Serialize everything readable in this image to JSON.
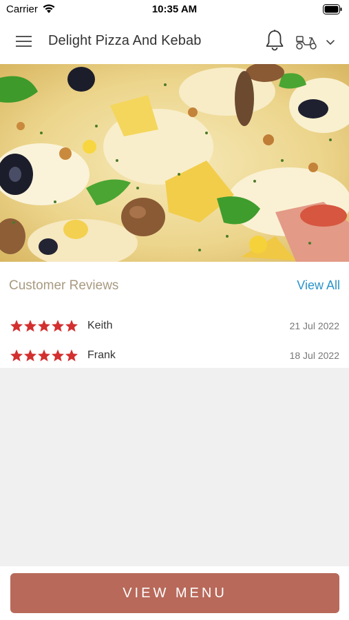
{
  "status_bar": {
    "carrier": "Carrier",
    "time": "10:35 AM"
  },
  "nav": {
    "title": "Delight Pizza And Kebab",
    "menu_icon": "hamburger-menu-icon",
    "notification_icon": "bell-icon",
    "order_mode_icon": "scooter-icon",
    "dropdown_icon": "chevron-down-icon"
  },
  "hero": {
    "image": "pizza-photo"
  },
  "reviews": {
    "heading": "Customer Reviews",
    "view_all_label": "View All",
    "items": [
      {
        "rating": 5,
        "max_rating": 5,
        "name": "Keith",
        "date": "21 Jul 2022"
      },
      {
        "rating": 5,
        "max_rating": 5,
        "name": "Frank",
        "date": "18 Jul 2022"
      }
    ]
  },
  "footer": {
    "button_label": "VIEW MENU"
  },
  "colors": {
    "accent": "#b8695a",
    "link": "#2a93c9",
    "star": "#d32f2f",
    "heading_muted": "#a89a80"
  }
}
